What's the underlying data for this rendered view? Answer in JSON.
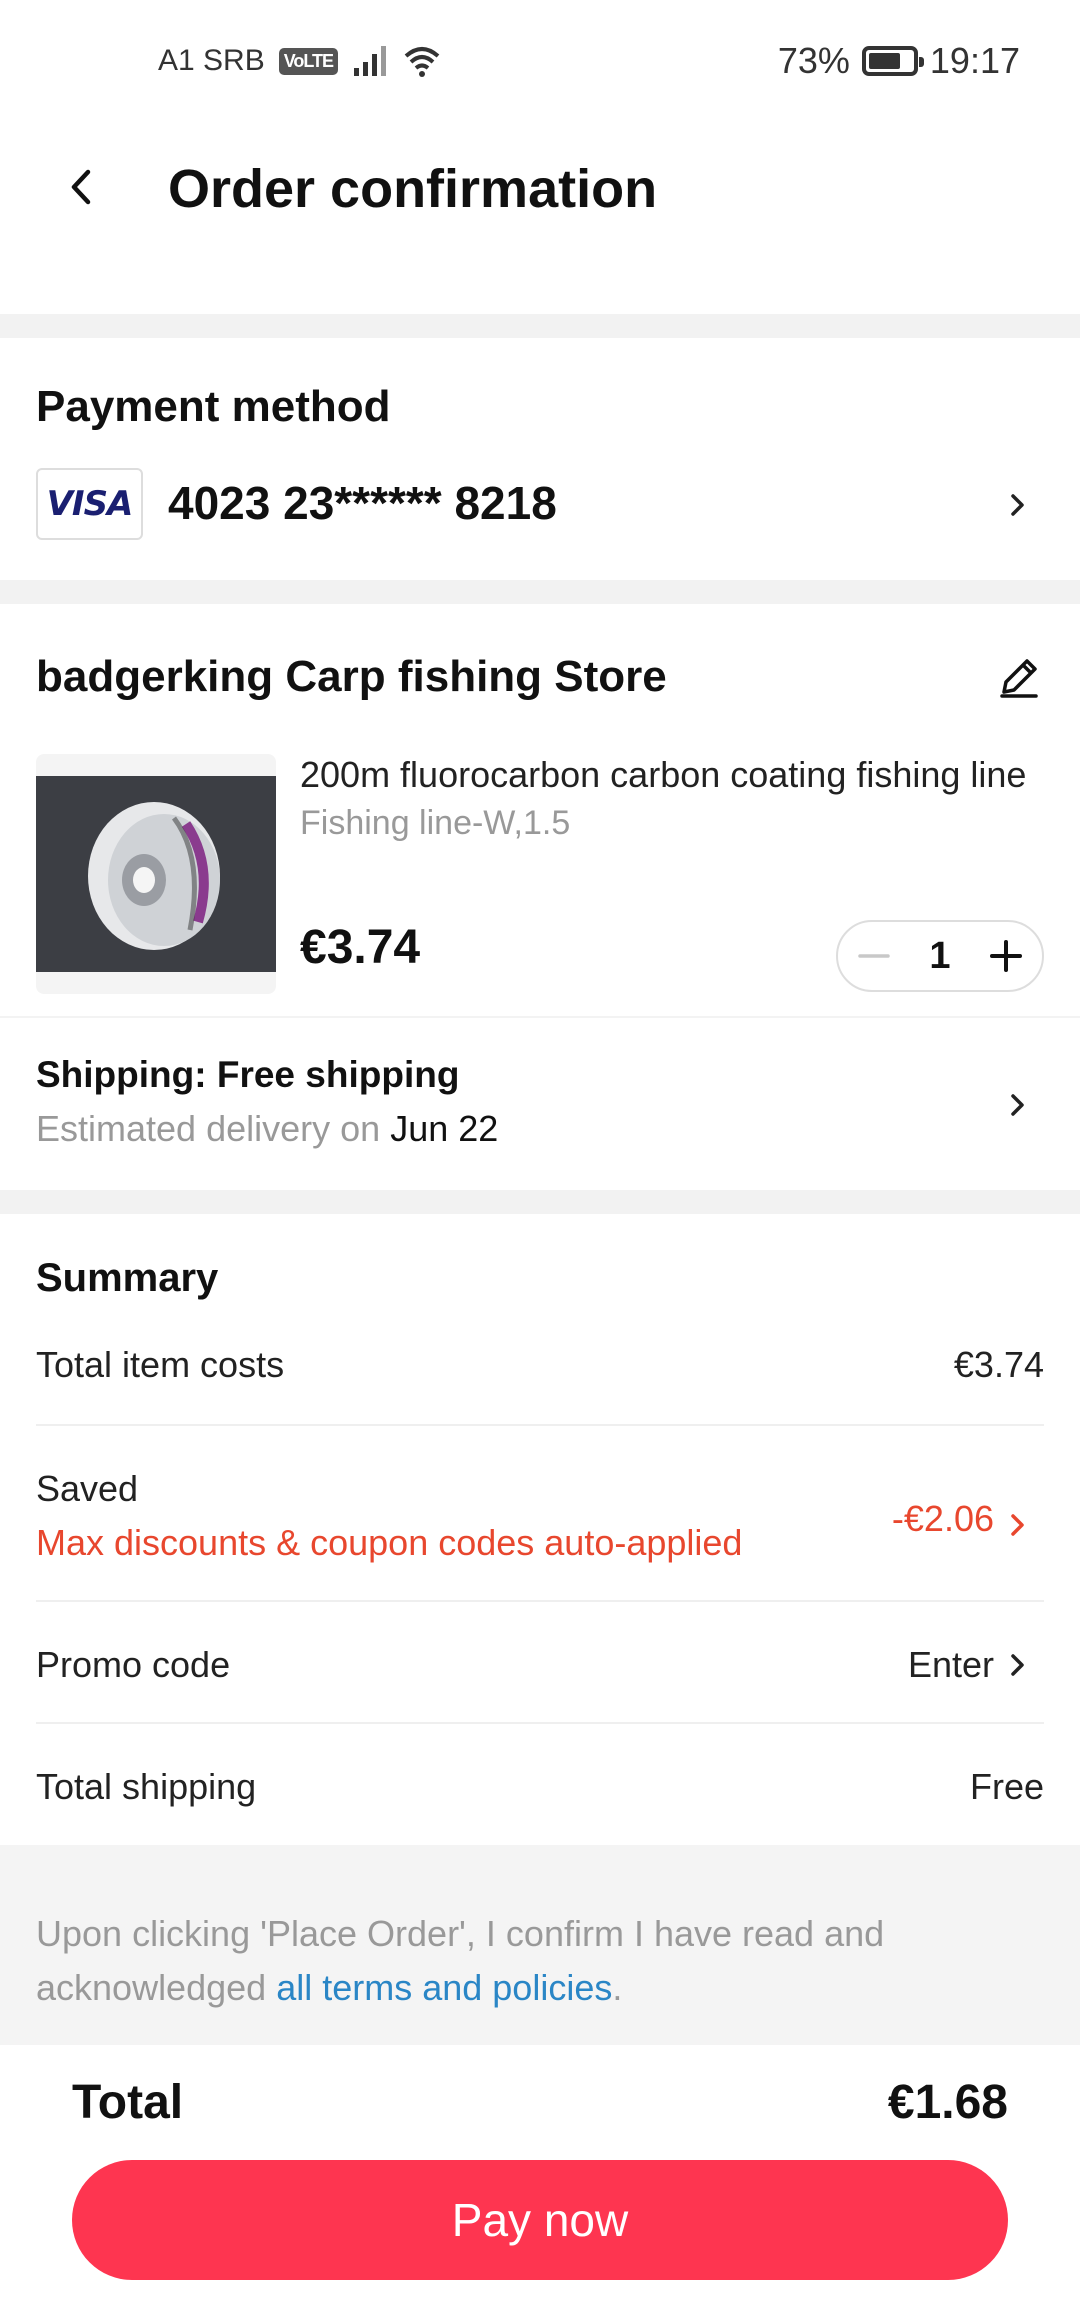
{
  "status_bar": {
    "carrier": "A1 SRB",
    "volte": "VoLTE",
    "battery": "73%",
    "battery_level": 0.73,
    "time": "19:17"
  },
  "header": {
    "title": "Order confirmation"
  },
  "payment": {
    "title": "Payment method",
    "card_brand": "VISA",
    "card_number": "4023 23****** 8218"
  },
  "store": {
    "name": "badgerking Carp fishing Store",
    "product": {
      "title": "200m fluorocarbon carbon coating fishing line",
      "variant": "Fishing line-W,1.5",
      "price": "€3.74",
      "quantity": "1"
    },
    "shipping": {
      "title": "Shipping: Free shipping",
      "est_label": "Estimated delivery on",
      "est_date": "Jun 22"
    }
  },
  "summary": {
    "title": "Summary",
    "item_costs_label": "Total item costs",
    "item_costs_value": "€3.74",
    "saved_label": "Saved",
    "saved_note": "Max discounts & coupon codes auto-applied",
    "saved_value": "-€2.06",
    "promo_label": "Promo code",
    "promo_value": "Enter",
    "shipping_label": "Total shipping",
    "shipping_value": "Free"
  },
  "terms": {
    "text": "Upon clicking 'Place Order', I confirm I have read and acknowledged",
    "link": "all terms and policies",
    "period": "."
  },
  "footer": {
    "total_label": "Total",
    "total_value": "€1.68",
    "pay_label": "Pay now"
  },
  "colors": {
    "accent": "#fe3550",
    "discount_red": "#e8472e",
    "link_blue": "#2a86c6"
  }
}
